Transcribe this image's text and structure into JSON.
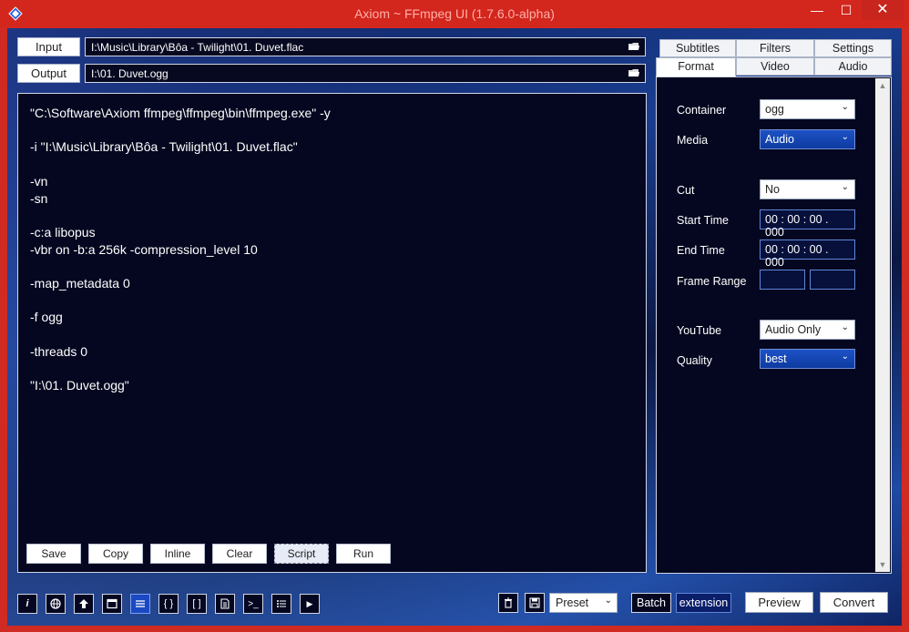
{
  "window": {
    "title": "Axiom ~ FFmpeg UI (1.7.6.0-alpha)",
    "minimize_glyph": "—",
    "maximize_glyph": "☐",
    "close_glyph": "✕"
  },
  "io": {
    "input_label": "Input",
    "input_value": "I:\\Music\\Library\\Bôa - Twilight\\01. Duvet.flac",
    "output_label": "Output",
    "output_value": "I:\\01. Duvet.ogg"
  },
  "script": {
    "lines": [
      "\"C:\\Software\\Axiom ffmpeg\\ffmpeg\\bin\\ffmpeg.exe\" -y",
      "",
      "-i \"I:\\Music\\Library\\Bôa - Twilight\\01. Duvet.flac\"",
      "",
      "-vn",
      "-sn",
      "",
      "-c:a libopus",
      "-vbr on -b:a 256k -compression_level 10",
      "",
      "-map_metadata 0",
      "",
      "-f ogg",
      "",
      "-threads 0",
      "",
      "\"I:\\01. Duvet.ogg\""
    ]
  },
  "actions": {
    "save": "Save",
    "copy": "Copy",
    "inline": "Inline",
    "clear": "Clear",
    "script": "Script",
    "run": "Run"
  },
  "tabs": {
    "subtitles": "Subtitles",
    "filters": "Filters",
    "settings": "Settings",
    "format": "Format",
    "video": "Video",
    "audio": "Audio",
    "selected": "Format"
  },
  "format": {
    "container_label": "Container",
    "container_value": "ogg",
    "media_label": "Media",
    "media_value": "Audio",
    "cut_label": "Cut",
    "cut_value": "No",
    "start_label": "Start Time",
    "start_value": "00 : 00 : 00 . 000",
    "end_label": "End Time",
    "end_value": "00 : 00 : 00 . 000",
    "frame_range_label": "Frame Range",
    "frame_start_value": "",
    "frame_end_value": "",
    "youtube_label": "YouTube",
    "youtube_value": "Audio Only",
    "quality_label": "Quality",
    "quality_value": "best"
  },
  "toolbar": {
    "info_glyph": "i",
    "brackets_glyph": "{ }",
    "square_brackets_glyph": "[ ]",
    "prompt_glyph": ">_",
    "play_glyph": "▶",
    "preset_value": "Preset",
    "batch_label": "Batch",
    "extension_label": "extension",
    "preview_label": "Preview",
    "convert_label": "Convert"
  },
  "colors": {
    "title_bar": "#d3261d",
    "accent_blue": "#1b49c2",
    "panel_bg": "#050720"
  }
}
